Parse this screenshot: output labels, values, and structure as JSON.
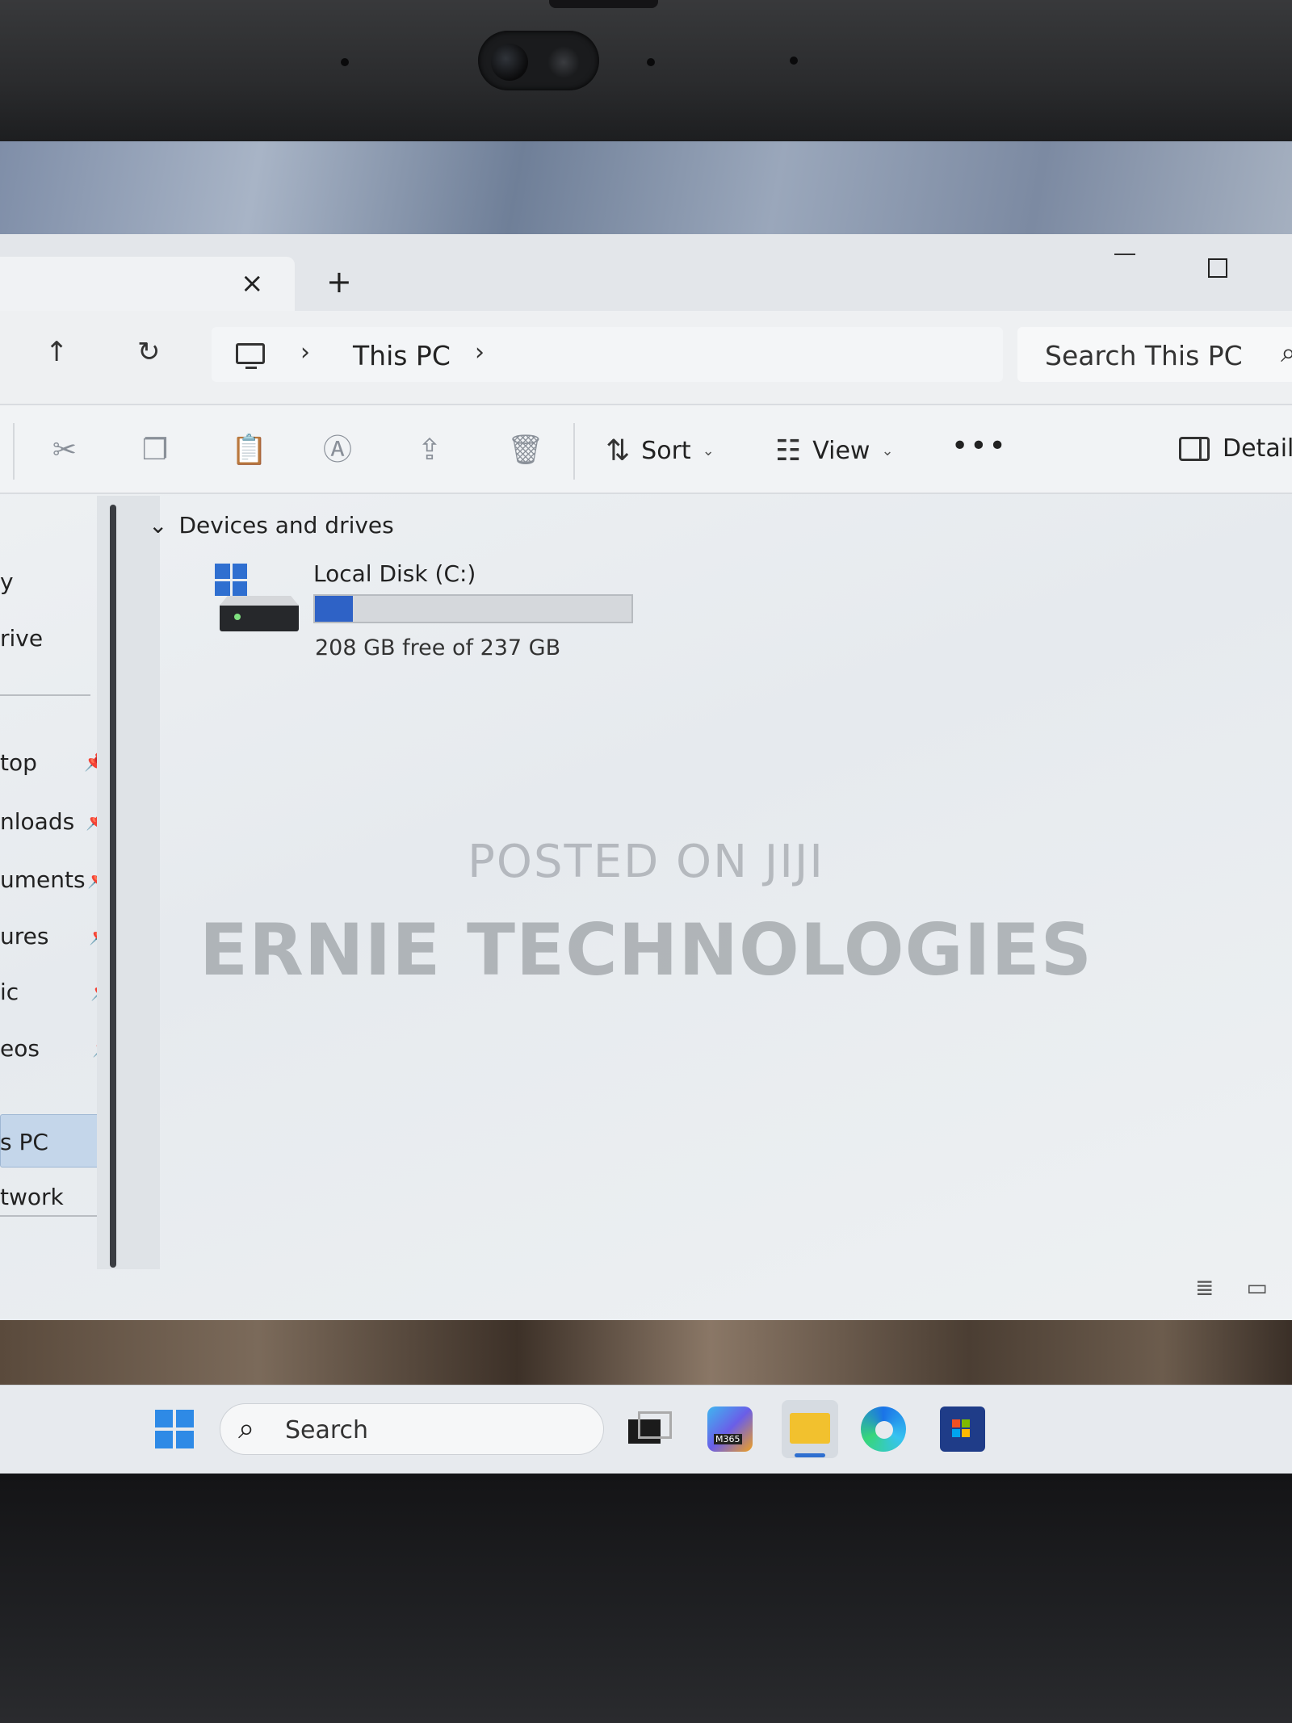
{
  "window": {
    "tab_close_glyph": "×",
    "new_tab_glyph": "+"
  },
  "address": {
    "breadcrumb": "This PC",
    "search_placeholder": "Search This PC"
  },
  "toolbar": {
    "sort_label": "Sort",
    "view_label": "View",
    "details_label": "Details",
    "more_glyph": "•••"
  },
  "sidebar": {
    "items": [
      {
        "label": "y",
        "pinned": false
      },
      {
        "label": "rive",
        "pinned": false
      },
      {
        "label": "top",
        "pinned": true
      },
      {
        "label": "nloads",
        "pinned": true
      },
      {
        "label": "uments",
        "pinned": true
      },
      {
        "label": "ures",
        "pinned": true
      },
      {
        "label": "ic",
        "pinned": true
      },
      {
        "label": "eos",
        "pinned": true
      },
      {
        "label": "s PC",
        "pinned": false,
        "selected": true
      },
      {
        "label": "twork",
        "pinned": false
      }
    ]
  },
  "content": {
    "group_title": "Devices and drives",
    "drives": [
      {
        "name": "Local Disk (C:)",
        "space_text": "208 GB free of 237 GB",
        "used_fraction": 0.12
      }
    ]
  },
  "watermark": {
    "line1": "POSTED ON JIJI",
    "line2": "ERNIE TECHNOLOGIES"
  },
  "taskbar": {
    "search_label": "Search",
    "m365_badge": "M365"
  },
  "colors": {
    "accent": "#2e62c6",
    "selection": "#c4d6ea"
  }
}
